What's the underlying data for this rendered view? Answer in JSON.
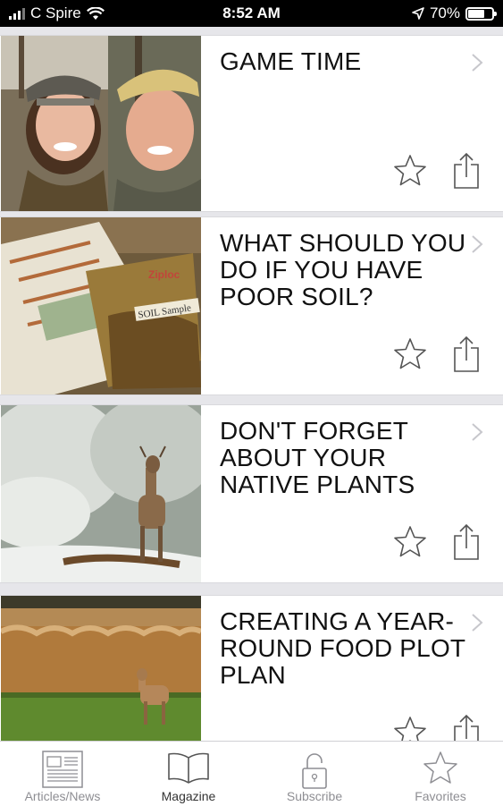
{
  "status_bar": {
    "carrier": "C Spire",
    "time": "8:52 AM",
    "battery_percent": "70%",
    "battery_level": 0.7
  },
  "articles": [
    {
      "title": "GAME TIME",
      "image": "photo-couple-selfie"
    },
    {
      "title": "WHAT SHOULD YOU DO IF YOU HAVE POOR SOIL?",
      "image": "photo-soil-sample-bag"
    },
    {
      "title": "DON'T FORGET ABOUT YOUR NATIVE PLANTS",
      "image": "photo-deer-in-snow"
    },
    {
      "title": "CREATING A YEAR-ROUND FOOD PLOT PLAN",
      "image": "photo-deer-in-field"
    }
  ],
  "tabbar": {
    "tabs": [
      {
        "label": "Articles/News",
        "icon": "newspaper-icon"
      },
      {
        "label": "Magazine",
        "icon": "open-book-icon",
        "active": true
      },
      {
        "label": "Subscribe",
        "icon": "lock-icon"
      },
      {
        "label": "Favorites",
        "icon": "star-icon"
      }
    ]
  },
  "colors": {
    "separator": "#e6e6ea",
    "icon_gray": "#555555",
    "tab_gray": "#8e8e93"
  }
}
